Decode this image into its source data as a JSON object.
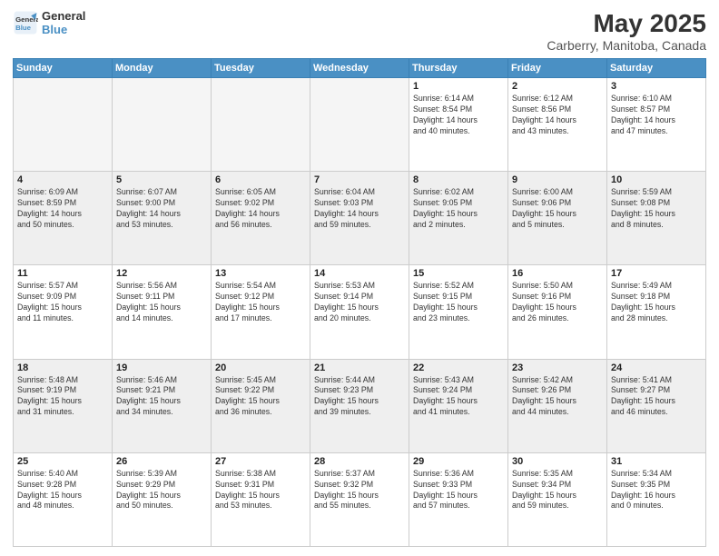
{
  "header": {
    "logo_line1": "General",
    "logo_line2": "Blue",
    "main_title": "May 2025",
    "sub_title": "Carberry, Manitoba, Canada"
  },
  "days_of_week": [
    "Sunday",
    "Monday",
    "Tuesday",
    "Wednesday",
    "Thursday",
    "Friday",
    "Saturday"
  ],
  "weeks": [
    [
      {
        "day": "",
        "info": ""
      },
      {
        "day": "",
        "info": ""
      },
      {
        "day": "",
        "info": ""
      },
      {
        "day": "",
        "info": ""
      },
      {
        "day": "1",
        "info": "Sunrise: 6:14 AM\nSunset: 8:54 PM\nDaylight: 14 hours\nand 40 minutes."
      },
      {
        "day": "2",
        "info": "Sunrise: 6:12 AM\nSunset: 8:56 PM\nDaylight: 14 hours\nand 43 minutes."
      },
      {
        "day": "3",
        "info": "Sunrise: 6:10 AM\nSunset: 8:57 PM\nDaylight: 14 hours\nand 47 minutes."
      }
    ],
    [
      {
        "day": "4",
        "info": "Sunrise: 6:09 AM\nSunset: 8:59 PM\nDaylight: 14 hours\nand 50 minutes."
      },
      {
        "day": "5",
        "info": "Sunrise: 6:07 AM\nSunset: 9:00 PM\nDaylight: 14 hours\nand 53 minutes."
      },
      {
        "day": "6",
        "info": "Sunrise: 6:05 AM\nSunset: 9:02 PM\nDaylight: 14 hours\nand 56 minutes."
      },
      {
        "day": "7",
        "info": "Sunrise: 6:04 AM\nSunset: 9:03 PM\nDaylight: 14 hours\nand 59 minutes."
      },
      {
        "day": "8",
        "info": "Sunrise: 6:02 AM\nSunset: 9:05 PM\nDaylight: 15 hours\nand 2 minutes."
      },
      {
        "day": "9",
        "info": "Sunrise: 6:00 AM\nSunset: 9:06 PM\nDaylight: 15 hours\nand 5 minutes."
      },
      {
        "day": "10",
        "info": "Sunrise: 5:59 AM\nSunset: 9:08 PM\nDaylight: 15 hours\nand 8 minutes."
      }
    ],
    [
      {
        "day": "11",
        "info": "Sunrise: 5:57 AM\nSunset: 9:09 PM\nDaylight: 15 hours\nand 11 minutes."
      },
      {
        "day": "12",
        "info": "Sunrise: 5:56 AM\nSunset: 9:11 PM\nDaylight: 15 hours\nand 14 minutes."
      },
      {
        "day": "13",
        "info": "Sunrise: 5:54 AM\nSunset: 9:12 PM\nDaylight: 15 hours\nand 17 minutes."
      },
      {
        "day": "14",
        "info": "Sunrise: 5:53 AM\nSunset: 9:14 PM\nDaylight: 15 hours\nand 20 minutes."
      },
      {
        "day": "15",
        "info": "Sunrise: 5:52 AM\nSunset: 9:15 PM\nDaylight: 15 hours\nand 23 minutes."
      },
      {
        "day": "16",
        "info": "Sunrise: 5:50 AM\nSunset: 9:16 PM\nDaylight: 15 hours\nand 26 minutes."
      },
      {
        "day": "17",
        "info": "Sunrise: 5:49 AM\nSunset: 9:18 PM\nDaylight: 15 hours\nand 28 minutes."
      }
    ],
    [
      {
        "day": "18",
        "info": "Sunrise: 5:48 AM\nSunset: 9:19 PM\nDaylight: 15 hours\nand 31 minutes."
      },
      {
        "day": "19",
        "info": "Sunrise: 5:46 AM\nSunset: 9:21 PM\nDaylight: 15 hours\nand 34 minutes."
      },
      {
        "day": "20",
        "info": "Sunrise: 5:45 AM\nSunset: 9:22 PM\nDaylight: 15 hours\nand 36 minutes."
      },
      {
        "day": "21",
        "info": "Sunrise: 5:44 AM\nSunset: 9:23 PM\nDaylight: 15 hours\nand 39 minutes."
      },
      {
        "day": "22",
        "info": "Sunrise: 5:43 AM\nSunset: 9:24 PM\nDaylight: 15 hours\nand 41 minutes."
      },
      {
        "day": "23",
        "info": "Sunrise: 5:42 AM\nSunset: 9:26 PM\nDaylight: 15 hours\nand 44 minutes."
      },
      {
        "day": "24",
        "info": "Sunrise: 5:41 AM\nSunset: 9:27 PM\nDaylight: 15 hours\nand 46 minutes."
      }
    ],
    [
      {
        "day": "25",
        "info": "Sunrise: 5:40 AM\nSunset: 9:28 PM\nDaylight: 15 hours\nand 48 minutes."
      },
      {
        "day": "26",
        "info": "Sunrise: 5:39 AM\nSunset: 9:29 PM\nDaylight: 15 hours\nand 50 minutes."
      },
      {
        "day": "27",
        "info": "Sunrise: 5:38 AM\nSunset: 9:31 PM\nDaylight: 15 hours\nand 53 minutes."
      },
      {
        "day": "28",
        "info": "Sunrise: 5:37 AM\nSunset: 9:32 PM\nDaylight: 15 hours\nand 55 minutes."
      },
      {
        "day": "29",
        "info": "Sunrise: 5:36 AM\nSunset: 9:33 PM\nDaylight: 15 hours\nand 57 minutes."
      },
      {
        "day": "30",
        "info": "Sunrise: 5:35 AM\nSunset: 9:34 PM\nDaylight: 15 hours\nand 59 minutes."
      },
      {
        "day": "31",
        "info": "Sunrise: 5:34 AM\nSunset: 9:35 PM\nDaylight: 16 hours\nand 0 minutes."
      }
    ]
  ]
}
